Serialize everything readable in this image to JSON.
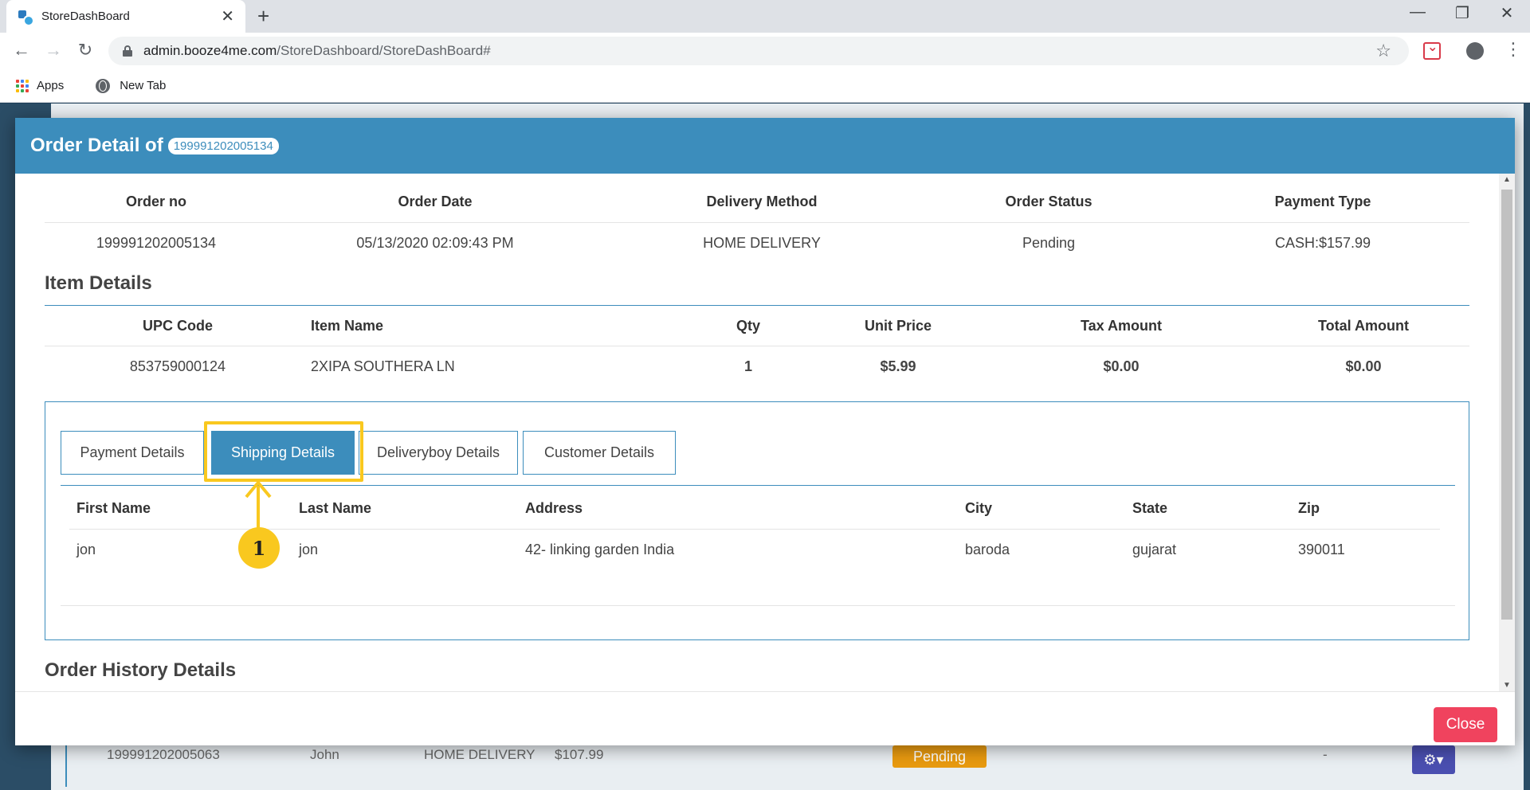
{
  "browser": {
    "tab_title": "StoreDashBoard",
    "url_host": "admin.booze4me.com",
    "url_path": "/StoreDashboard/StoreDashBoard#",
    "bookmarks": [
      {
        "label": "Apps"
      },
      {
        "label": "New Tab"
      }
    ]
  },
  "modal": {
    "title": "Order Detail of",
    "order_badge": "199991202005134",
    "close_label": "Close"
  },
  "order": {
    "headers": [
      "Order no",
      "Order Date",
      "Delivery Method",
      "Order Status",
      "Payment Type"
    ],
    "values": [
      "199991202005134",
      "05/13/2020 02:09:43 PM",
      "HOME DELIVERY",
      "Pending",
      "CASH:$157.99"
    ]
  },
  "items": {
    "title": "Item Details",
    "headers": [
      "UPC Code",
      "Item Name",
      "Qty",
      "Unit Price",
      "Tax Amount",
      "Total Amount"
    ],
    "rows": [
      [
        "853759000124",
        "2XIPA SOUTHERA LN",
        "1",
        "$5.99",
        "$0.00",
        "$0.00"
      ]
    ]
  },
  "tabs": [
    {
      "label": "Payment Details",
      "active": false
    },
    {
      "label": "Shipping Details",
      "active": true
    },
    {
      "label": "Deliveryboy Details",
      "active": false
    },
    {
      "label": "Customer Details",
      "active": false
    }
  ],
  "shipping": {
    "headers": [
      "First Name",
      "Last Name",
      "Address",
      "City",
      "State",
      "Zip"
    ],
    "rows": [
      [
        "jon",
        "jon",
        "42- linking garden India",
        "baroda",
        "gujarat",
        "390011"
      ]
    ]
  },
  "history": {
    "title": "Order History Details"
  },
  "background_row": {
    "order_no": "199991202005063",
    "name": "John",
    "method": "HOME DELIVERY",
    "amount": "$107.99",
    "status": "Pending",
    "dash": "-"
  },
  "annotation": {
    "step": "1"
  },
  "colors": {
    "primary": "#3c8dbc",
    "close": "#f0435e",
    "annotation": "#f9c81f",
    "pending": "#e89a10"
  }
}
